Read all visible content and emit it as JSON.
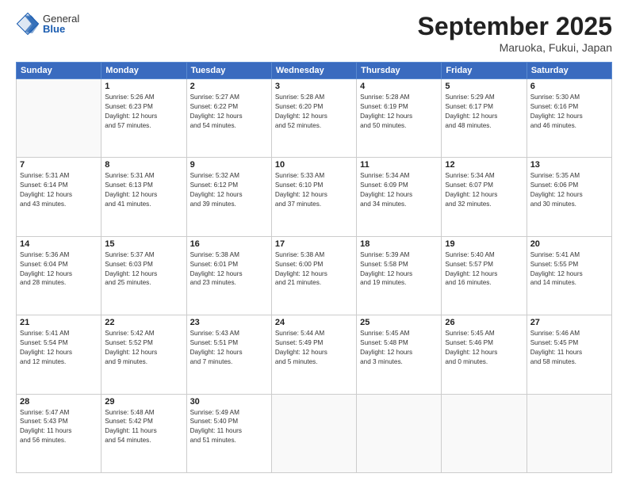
{
  "header": {
    "logo_general": "General",
    "logo_blue": "Blue",
    "month_title": "September 2025",
    "location": "Maruoka, Fukui, Japan"
  },
  "days_of_week": [
    "Sunday",
    "Monday",
    "Tuesday",
    "Wednesday",
    "Thursday",
    "Friday",
    "Saturday"
  ],
  "weeks": [
    [
      {
        "day": "",
        "info": ""
      },
      {
        "day": "1",
        "info": "Sunrise: 5:26 AM\nSunset: 6:23 PM\nDaylight: 12 hours\nand 57 minutes."
      },
      {
        "day": "2",
        "info": "Sunrise: 5:27 AM\nSunset: 6:22 PM\nDaylight: 12 hours\nand 54 minutes."
      },
      {
        "day": "3",
        "info": "Sunrise: 5:28 AM\nSunset: 6:20 PM\nDaylight: 12 hours\nand 52 minutes."
      },
      {
        "day": "4",
        "info": "Sunrise: 5:28 AM\nSunset: 6:19 PM\nDaylight: 12 hours\nand 50 minutes."
      },
      {
        "day": "5",
        "info": "Sunrise: 5:29 AM\nSunset: 6:17 PM\nDaylight: 12 hours\nand 48 minutes."
      },
      {
        "day": "6",
        "info": "Sunrise: 5:30 AM\nSunset: 6:16 PM\nDaylight: 12 hours\nand 46 minutes."
      }
    ],
    [
      {
        "day": "7",
        "info": "Sunrise: 5:31 AM\nSunset: 6:14 PM\nDaylight: 12 hours\nand 43 minutes."
      },
      {
        "day": "8",
        "info": "Sunrise: 5:31 AM\nSunset: 6:13 PM\nDaylight: 12 hours\nand 41 minutes."
      },
      {
        "day": "9",
        "info": "Sunrise: 5:32 AM\nSunset: 6:12 PM\nDaylight: 12 hours\nand 39 minutes."
      },
      {
        "day": "10",
        "info": "Sunrise: 5:33 AM\nSunset: 6:10 PM\nDaylight: 12 hours\nand 37 minutes."
      },
      {
        "day": "11",
        "info": "Sunrise: 5:34 AM\nSunset: 6:09 PM\nDaylight: 12 hours\nand 34 minutes."
      },
      {
        "day": "12",
        "info": "Sunrise: 5:34 AM\nSunset: 6:07 PM\nDaylight: 12 hours\nand 32 minutes."
      },
      {
        "day": "13",
        "info": "Sunrise: 5:35 AM\nSunset: 6:06 PM\nDaylight: 12 hours\nand 30 minutes."
      }
    ],
    [
      {
        "day": "14",
        "info": "Sunrise: 5:36 AM\nSunset: 6:04 PM\nDaylight: 12 hours\nand 28 minutes."
      },
      {
        "day": "15",
        "info": "Sunrise: 5:37 AM\nSunset: 6:03 PM\nDaylight: 12 hours\nand 25 minutes."
      },
      {
        "day": "16",
        "info": "Sunrise: 5:38 AM\nSunset: 6:01 PM\nDaylight: 12 hours\nand 23 minutes."
      },
      {
        "day": "17",
        "info": "Sunrise: 5:38 AM\nSunset: 6:00 PM\nDaylight: 12 hours\nand 21 minutes."
      },
      {
        "day": "18",
        "info": "Sunrise: 5:39 AM\nSunset: 5:58 PM\nDaylight: 12 hours\nand 19 minutes."
      },
      {
        "day": "19",
        "info": "Sunrise: 5:40 AM\nSunset: 5:57 PM\nDaylight: 12 hours\nand 16 minutes."
      },
      {
        "day": "20",
        "info": "Sunrise: 5:41 AM\nSunset: 5:55 PM\nDaylight: 12 hours\nand 14 minutes."
      }
    ],
    [
      {
        "day": "21",
        "info": "Sunrise: 5:41 AM\nSunset: 5:54 PM\nDaylight: 12 hours\nand 12 minutes."
      },
      {
        "day": "22",
        "info": "Sunrise: 5:42 AM\nSunset: 5:52 PM\nDaylight: 12 hours\nand 9 minutes."
      },
      {
        "day": "23",
        "info": "Sunrise: 5:43 AM\nSunset: 5:51 PM\nDaylight: 12 hours\nand 7 minutes."
      },
      {
        "day": "24",
        "info": "Sunrise: 5:44 AM\nSunset: 5:49 PM\nDaylight: 12 hours\nand 5 minutes."
      },
      {
        "day": "25",
        "info": "Sunrise: 5:45 AM\nSunset: 5:48 PM\nDaylight: 12 hours\nand 3 minutes."
      },
      {
        "day": "26",
        "info": "Sunrise: 5:45 AM\nSunset: 5:46 PM\nDaylight: 12 hours\nand 0 minutes."
      },
      {
        "day": "27",
        "info": "Sunrise: 5:46 AM\nSunset: 5:45 PM\nDaylight: 11 hours\nand 58 minutes."
      }
    ],
    [
      {
        "day": "28",
        "info": "Sunrise: 5:47 AM\nSunset: 5:43 PM\nDaylight: 11 hours\nand 56 minutes."
      },
      {
        "day": "29",
        "info": "Sunrise: 5:48 AM\nSunset: 5:42 PM\nDaylight: 11 hours\nand 54 minutes."
      },
      {
        "day": "30",
        "info": "Sunrise: 5:49 AM\nSunset: 5:40 PM\nDaylight: 11 hours\nand 51 minutes."
      },
      {
        "day": "",
        "info": ""
      },
      {
        "day": "",
        "info": ""
      },
      {
        "day": "",
        "info": ""
      },
      {
        "day": "",
        "info": ""
      }
    ]
  ]
}
